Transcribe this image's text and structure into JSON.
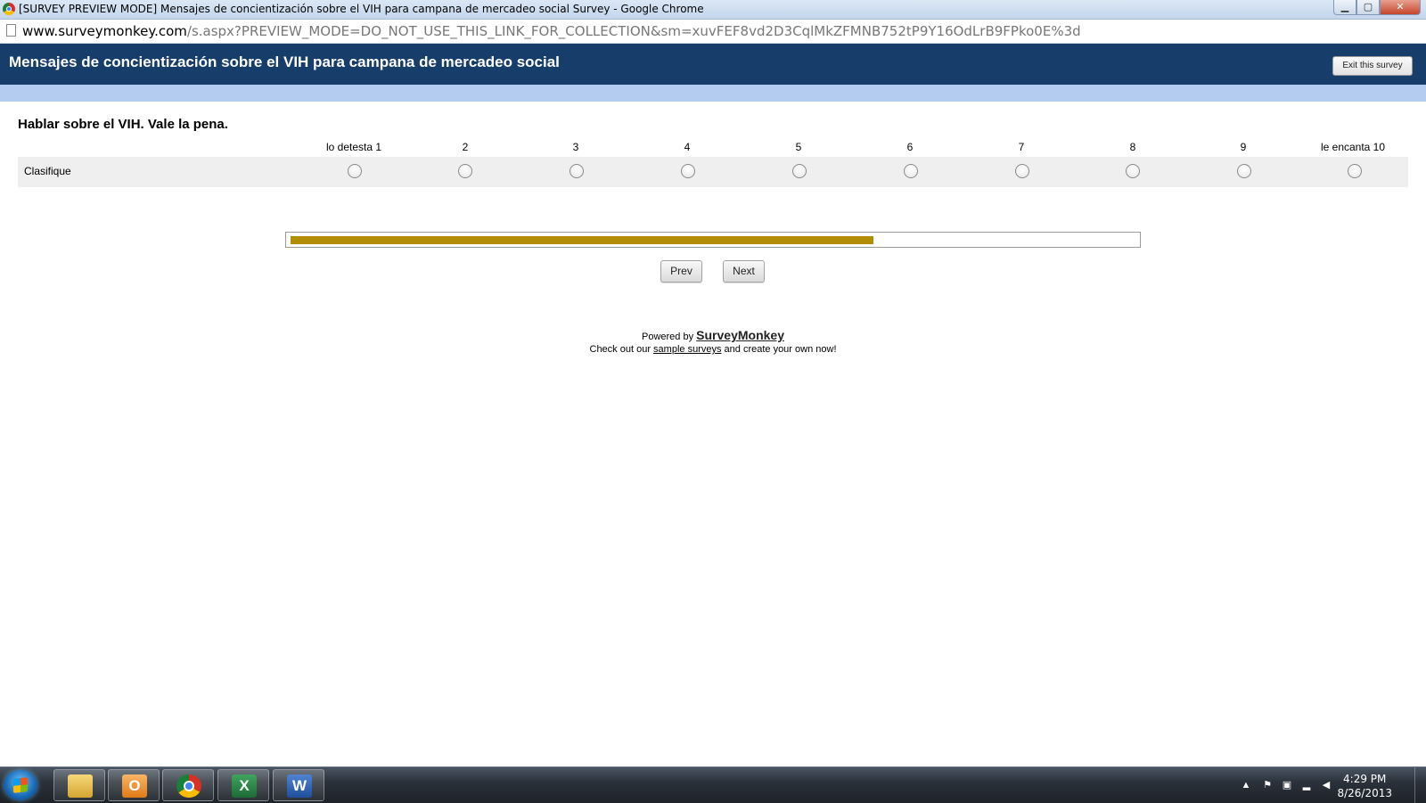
{
  "window": {
    "title": "[SURVEY PREVIEW MODE] Mensajes de concientización sobre el VIH para campana de mercadeo social Survey - Google Chrome",
    "controls": {
      "minimize": "▁",
      "maximize": "▢",
      "close": "✕"
    }
  },
  "address_bar": {
    "domain": "www.surveymonkey.com",
    "path": "/s.aspx?PREVIEW_MODE=DO_NOT_USE_THIS_LINK_FOR_COLLECTION&sm=xuvFEF8vd2D3CqlMkZFMNB752tP9Y16OdLrB9FPko0E%3d"
  },
  "survey": {
    "title": "Mensajes de concientización sobre el VIH para campana de mercadeo social",
    "exit_label": "Exit this survey",
    "colors": {
      "header": "#173d6b",
      "stripe": "#b4ccef",
      "progress": "#b28d00"
    }
  },
  "question": {
    "text": "Hablar sobre el VIH. Vale la pena.",
    "scale": [
      "lo detesta 1",
      "2",
      "3",
      "4",
      "5",
      "6",
      "7",
      "8",
      "9",
      "le encanta 10"
    ],
    "row_label": "Clasifique",
    "selected": null
  },
  "progress": {
    "fraction": 0.69
  },
  "navigation": {
    "prev_label": "Prev",
    "next_label": "Next"
  },
  "footer": {
    "powered_prefix": "Powered by",
    "brand": "SurveyMonkey",
    "checkout_prefix": "Check out our",
    "checkout_link": "sample surveys",
    "checkout_suffix": "and create your own now!"
  },
  "taskbar": {
    "apps": [
      {
        "name": "explorer",
        "icon": "folder-icon",
        "glyph": ""
      },
      {
        "name": "outlook",
        "icon": "outlook-icon",
        "glyph": "O"
      },
      {
        "name": "chrome",
        "icon": "chrome-icon",
        "glyph": ""
      },
      {
        "name": "excel",
        "icon": "excel-icon",
        "glyph": "X"
      },
      {
        "name": "word",
        "icon": "word-icon",
        "glyph": "W"
      }
    ],
    "clock": {
      "time": "4:29 PM",
      "date": "8/26/2013"
    }
  }
}
